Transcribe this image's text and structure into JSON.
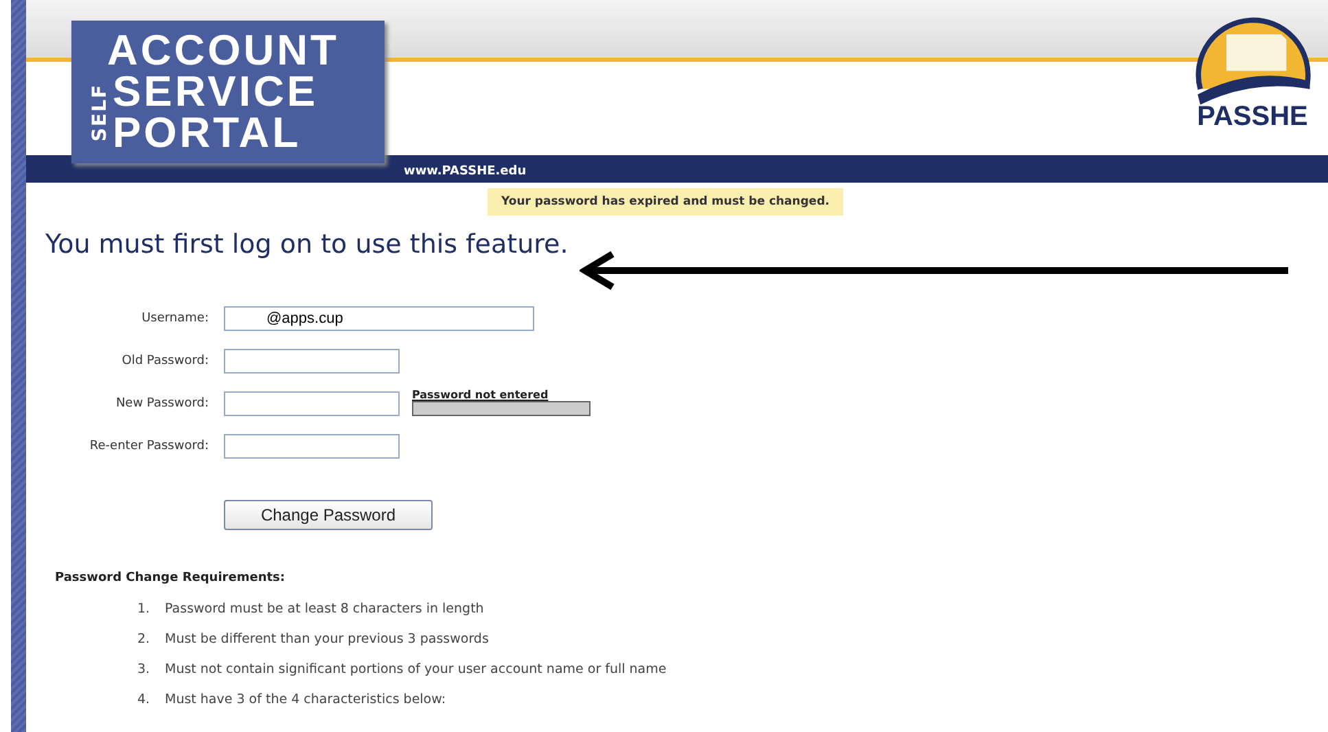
{
  "header": {
    "logo": {
      "line_1": "ACCOUNT",
      "line_2": "SERVICE",
      "line_3": "PORTAL",
      "side_word": "SELF"
    },
    "url": "www.PASSHE.edu",
    "brand": "PASSHE"
  },
  "notice": "Your password has expired and must be changed.",
  "heading": "You must first log on to use this feature.",
  "form": {
    "fields": [
      {
        "label": "Username:",
        "value": "@apps.cup",
        "kind": "wide"
      },
      {
        "label": "Old Password:",
        "kind": "short"
      },
      {
        "label": "New Password:",
        "kind": "meter"
      },
      {
        "label": "Re-enter Password:",
        "kind": "short"
      }
    ],
    "strength": {
      "label": "Password not entered"
    },
    "submit": "Change Password"
  },
  "requirements": {
    "title": "Password Change Requirements:",
    "items": [
      {
        "number": "1.",
        "text": "Password must be at least 8 characters in length"
      },
      {
        "number": "2.",
        "text": "Must be different than your previous 3 passwords"
      },
      {
        "number": "3.",
        "text": "Must not contain significant portions of your user account name or full name"
      },
      {
        "number": "4.",
        "text": "Must have 3 of the 4 characteristics below:"
      }
    ]
  }
}
